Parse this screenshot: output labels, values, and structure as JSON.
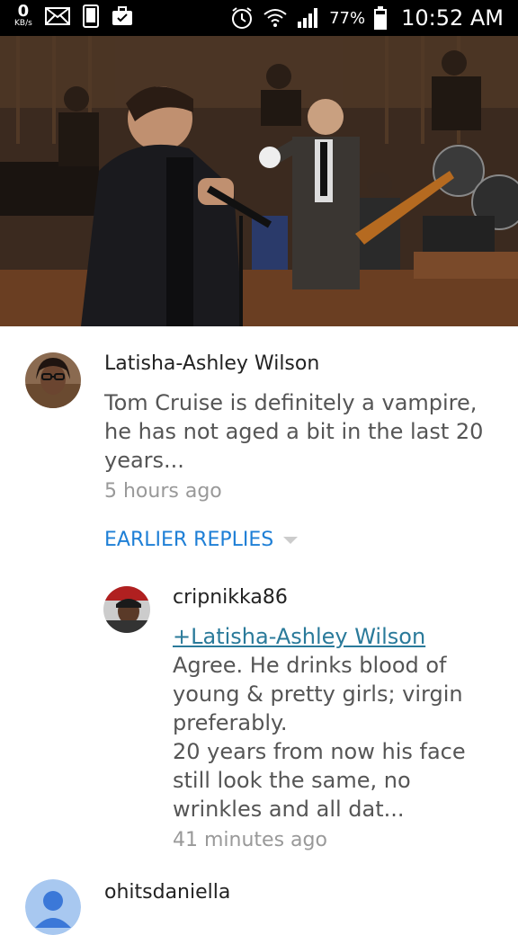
{
  "status_bar": {
    "net_speed_value": "0",
    "net_speed_unit": "KB/s",
    "battery_percent": "77%",
    "time": "10:52 AM",
    "icons": [
      "mail-icon",
      "phone-icon",
      "briefcase-icon",
      "alarm-icon",
      "wifi-icon",
      "signal-icon",
      "battery-icon"
    ]
  },
  "comments": [
    {
      "author": "Latisha-Ashley Wilson",
      "text": "Tom Cruise is definitely a vampire, he has not aged a bit in the last 20 years...",
      "time_ago": "5 hours ago"
    }
  ],
  "earlier_replies_label": "EARLIER REPLIES",
  "reply": {
    "author": "cripnikka86",
    "mention": "+Latisha-Ashley Wilson",
    "text_lines": [
      "Agree. He drinks blood of",
      "young & pretty girls; virgin",
      "preferably.",
      "20 years from now his face",
      "still look the same, no",
      "wrinkles and all dat..."
    ],
    "time_ago": "41 minutes ago"
  },
  "next_comment": {
    "author": "ohitsdaniella"
  }
}
